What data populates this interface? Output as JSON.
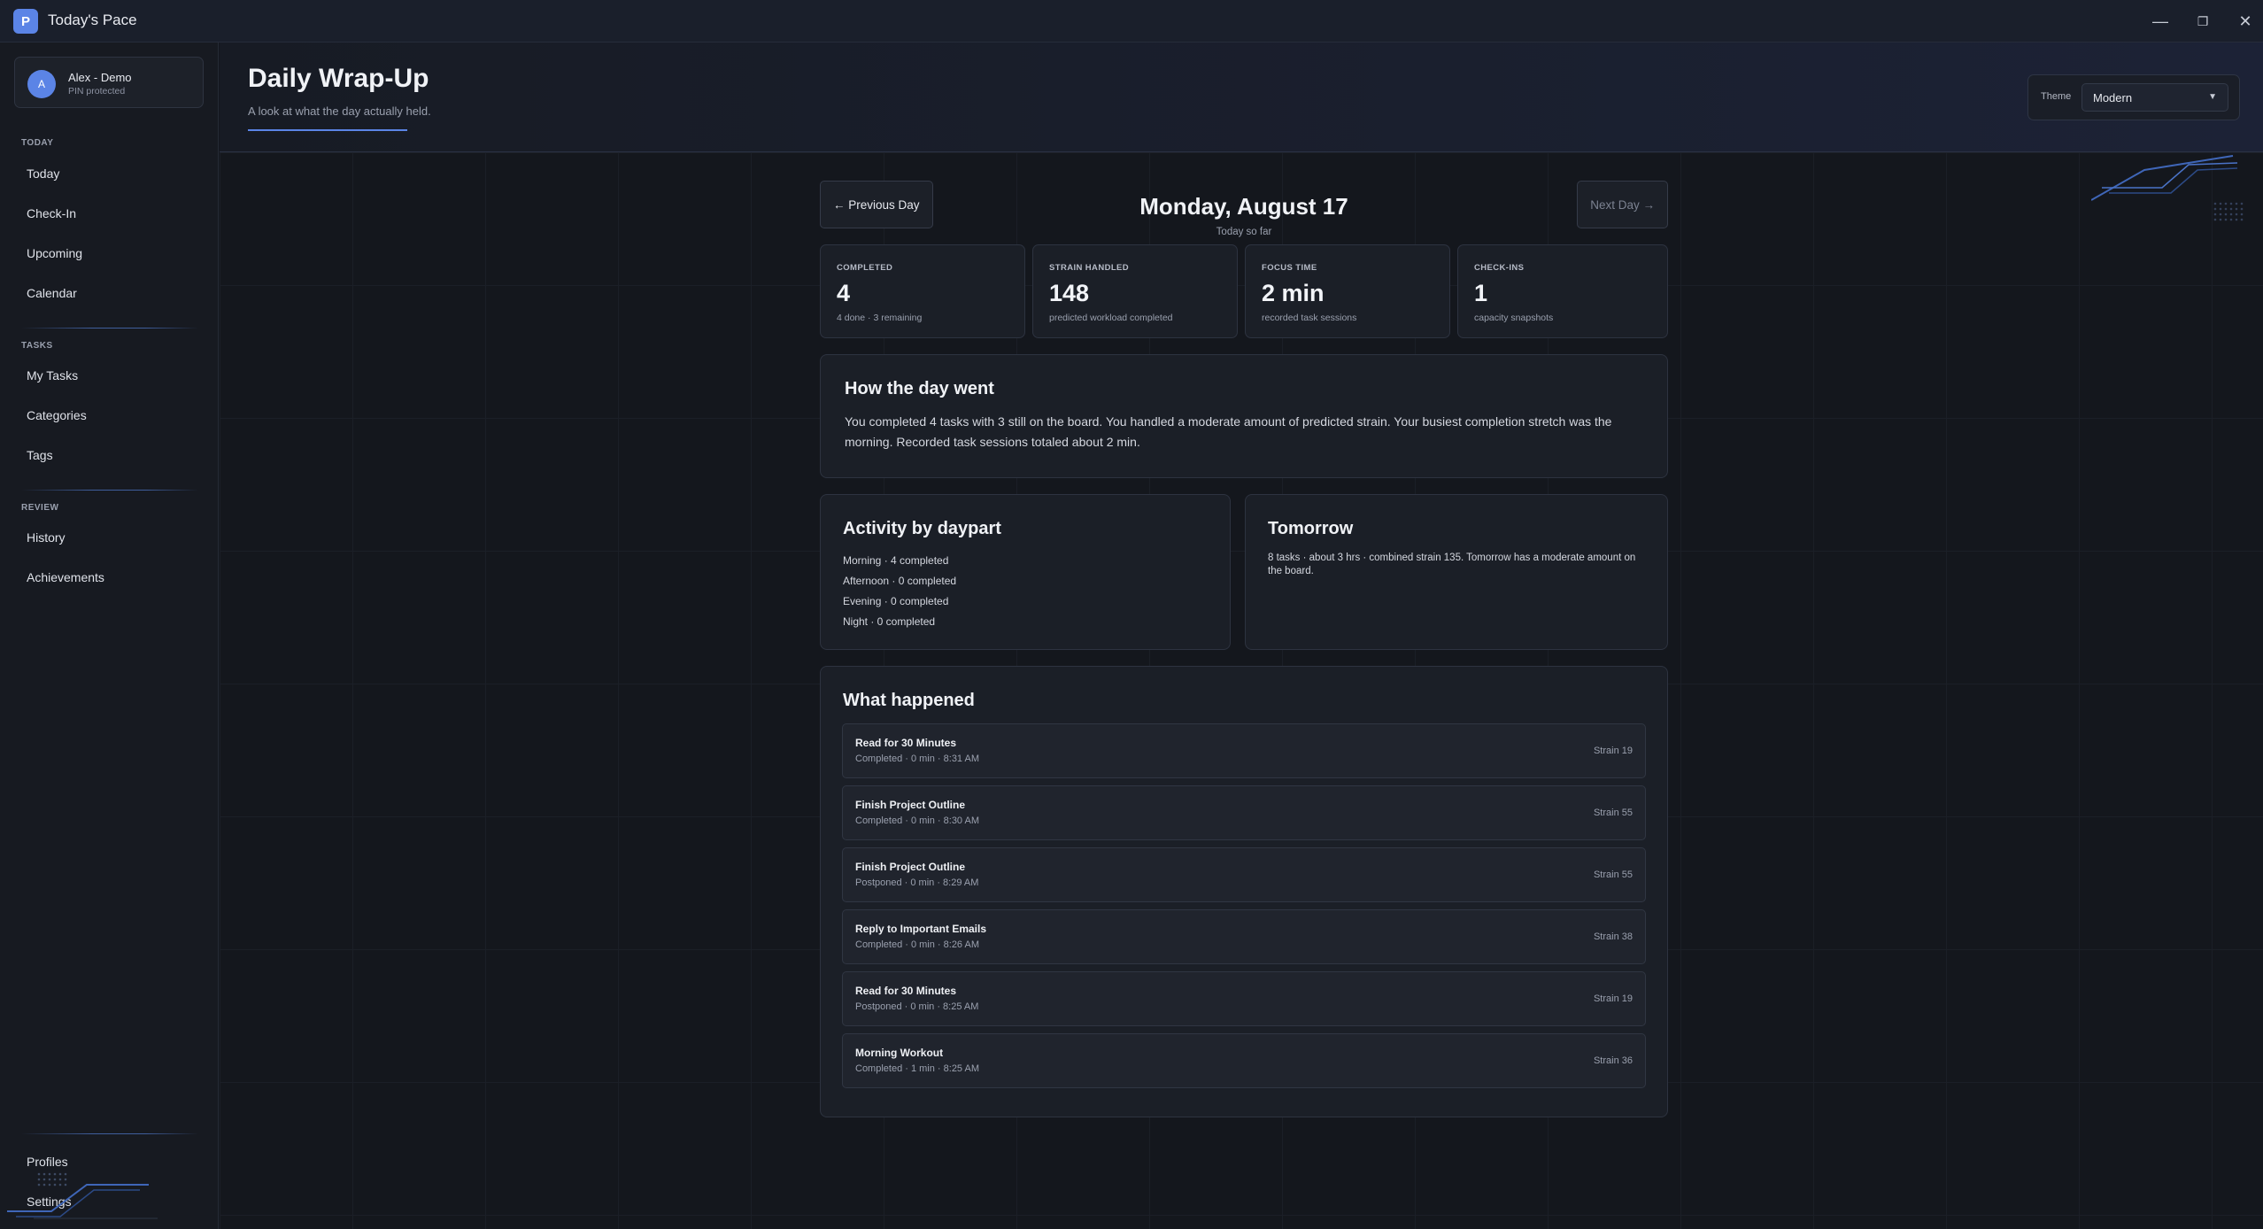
{
  "app": {
    "title": "Today's Pace",
    "logo_letter": "P",
    "window_controls": {
      "minimize": "—",
      "maximize": "❐",
      "close": "✕"
    }
  },
  "sidebar": {
    "profile": {
      "initial": "A",
      "name": "Alex - Demo",
      "subtitle": "PIN protected"
    },
    "sections": [
      {
        "label": "TODAY",
        "items": [
          "Today",
          "Check-In",
          "Upcoming",
          "Calendar"
        ]
      },
      {
        "label": "TASKS",
        "items": [
          "My Tasks",
          "Categories",
          "Tags"
        ]
      },
      {
        "label": "REVIEW",
        "items": [
          "History",
          "Achievements"
        ]
      }
    ],
    "footer_items": [
      "Profiles",
      "Settings"
    ]
  },
  "header": {
    "title": "Daily Wrap-Up",
    "subtitle": "A look at what the day actually held.",
    "theme_label": "Theme",
    "theme_value": "Modern"
  },
  "day_nav": {
    "prev": "← Previous Day",
    "next": "Next Day →",
    "date": "Monday, August 17",
    "date_sub": "Today so far"
  },
  "stats": [
    {
      "label": "COMPLETED",
      "value": "4",
      "sub": "4 done · 3 remaining"
    },
    {
      "label": "STRAIN HANDLED",
      "value": "148",
      "sub": "predicted workload completed"
    },
    {
      "label": "FOCUS TIME",
      "value": "2 min",
      "sub": "recorded task sessions"
    },
    {
      "label": "CHECK-INS",
      "value": "1",
      "sub": "capacity snapshots"
    }
  ],
  "summary": {
    "title": "How the day went",
    "body": "You completed 4 tasks with 3 still on the board. You handled a moderate amount of predicted strain. Your busiest completion stretch was the morning. Recorded task sessions totaled about 2 min."
  },
  "dayparts": {
    "title": "Activity by daypart",
    "lines": [
      "Morning · 4 completed",
      "Afternoon · 0 completed",
      "Evening · 0 completed",
      "Night · 0 completed"
    ]
  },
  "tomorrow": {
    "title": "Tomorrow",
    "body": "8 tasks · about 3 hrs · combined strain 135. Tomorrow has a moderate amount on the board."
  },
  "events": {
    "title": "What happened",
    "rows": [
      {
        "title": "Read for 30 Minutes",
        "sub": "Completed · 0 min · 8:31 AM",
        "strain": "Strain 19"
      },
      {
        "title": "Finish Project Outline",
        "sub": "Completed · 0 min · 8:30 AM",
        "strain": "Strain 55"
      },
      {
        "title": "Finish Project Outline",
        "sub": "Postponed · 0 min · 8:29 AM",
        "strain": "Strain 55"
      },
      {
        "title": "Reply to Important Emails",
        "sub": "Completed · 0 min · 8:26 AM",
        "strain": "Strain 38"
      },
      {
        "title": "Read for 30 Minutes",
        "sub": "Postponed · 0 min · 8:25 AM",
        "strain": "Strain 19"
      },
      {
        "title": "Morning Workout",
        "sub": "Completed · 1 min · 8:25 AM",
        "strain": "Strain 36"
      }
    ]
  },
  "colors": {
    "accent": "#5b84e6",
    "background": "#14171e",
    "card": "#1b1f27",
    "muted_text": "#9aa0ae"
  }
}
